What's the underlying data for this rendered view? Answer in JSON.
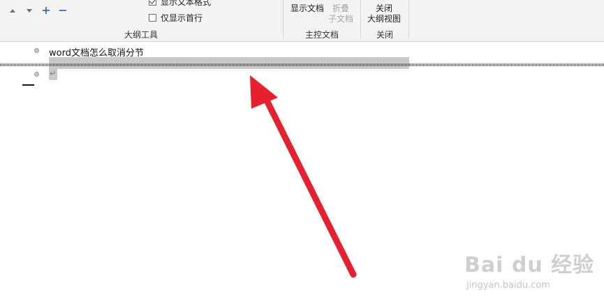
{
  "ribbon": {
    "outline_tools": {
      "group_label": "大纲工具",
      "show_text_formatting": "显示文本格式",
      "show_first_line_only": "仅显示首行",
      "show_text_formatting_checked": true,
      "show_first_line_only_checked": false
    },
    "master_document": {
      "group_label": "主控文档",
      "show_document": "显示文档",
      "collapse_subdocs_line1": "折叠",
      "collapse_subdocs_line2": "子文档"
    },
    "close": {
      "group_label": "关闭",
      "close_outline_line1": "关闭",
      "close_outline_line2": "大纲视图"
    }
  },
  "document": {
    "line1": "word文档怎么取消分节",
    "paragraph_mark": "↵"
  },
  "watermark": {
    "brand": "Bai du 经验",
    "url": "jingyan.baidu.com"
  },
  "colors": {
    "arrow": "#e8202e",
    "ribbon_bg": "#f3f3f3",
    "accent_blue": "#2e73c9"
  }
}
